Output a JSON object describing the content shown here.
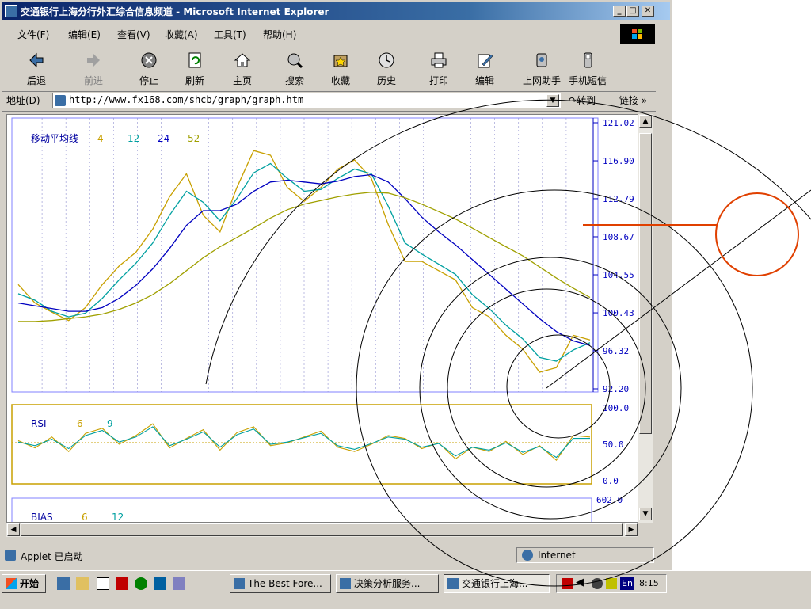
{
  "window": {
    "title": "交通银行上海分行外汇综合信息频道 - Microsoft Internet Explorer",
    "min": "_",
    "max": "□",
    "close": "✕"
  },
  "menu": [
    "文件(F)",
    "编辑(E)",
    "查看(V)",
    "收藏(A)",
    "工具(T)",
    "帮助(H)"
  ],
  "toolbar": [
    {
      "label": "后退",
      "icon": "back-arrow-icon"
    },
    {
      "label": "前进",
      "icon": "forward-arrow-icon"
    },
    {
      "label": "停止",
      "icon": "stop-icon"
    },
    {
      "label": "刷新",
      "icon": "refresh-icon"
    },
    {
      "label": "主页",
      "icon": "home-icon"
    },
    {
      "label": "搜索",
      "icon": "search-icon"
    },
    {
      "label": "收藏",
      "icon": "favorites-icon"
    },
    {
      "label": "历史",
      "icon": "history-icon"
    },
    {
      "label": "打印",
      "icon": "print-icon"
    },
    {
      "label": "编辑",
      "icon": "edit-icon"
    },
    {
      "label": "上网助手",
      "icon": "assistant-icon"
    },
    {
      "label": "手机短信",
      "icon": "sms-icon"
    }
  ],
  "address": {
    "label": "地址(D)",
    "url": "http://www.fx168.com/shcb/graph/graph.htm",
    "go": "转到",
    "links": "链接",
    "more": "»"
  },
  "chart_data": {
    "type": "line",
    "title": "移动平均线",
    "legend": [
      "4",
      "12",
      "24",
      "52"
    ],
    "legend_colors": [
      "#c8a000",
      "#00a0a0",
      "#0000c0",
      "#a0a000"
    ],
    "y_ticks": [
      "121.02",
      "116.90",
      "112.79",
      "108.67",
      "104.55",
      "100.43",
      "96.32",
      "92.20"
    ],
    "ylim": [
      92.2,
      121.02
    ],
    "series": [
      {
        "name": "4",
        "color": "#c8a000",
        "values": [
          103.5,
          101.5,
          100.5,
          99.6,
          101,
          103.5,
          105.5,
          107,
          109.5,
          113,
          115.5,
          111,
          109.2,
          114,
          118,
          117.5,
          114,
          112.5,
          114,
          116,
          117,
          115,
          110,
          106,
          106,
          105,
          104,
          101,
          100,
          98,
          96.5,
          94,
          94.5,
          98,
          97.5
        ]
      },
      {
        "name": "12",
        "color": "#00a0a0",
        "values": [
          102.5,
          101.8,
          100.6,
          100,
          100.4,
          102,
          104,
          105.8,
          108,
          111,
          113.6,
          112.4,
          110.4,
          112.8,
          115.6,
          116.6,
          115,
          113.6,
          113.8,
          115,
          116,
          115.5,
          112,
          108,
          106.8,
          105.7,
          104.6,
          102.4,
          100.9,
          99.1,
          97.6,
          95.6,
          95.2,
          96.4,
          97.2
        ]
      },
      {
        "name": "24",
        "color": "#0000c0",
        "values": [
          101.5,
          101.2,
          100.9,
          100.6,
          100.6,
          101,
          102,
          103.4,
          105.2,
          107.4,
          109.9,
          111.5,
          111.5,
          112.2,
          113.6,
          114.6,
          114.8,
          114.6,
          114.4,
          114.7,
          115.2,
          115.4,
          114.6,
          112.8,
          110.8,
          109.2,
          107.8,
          106.2,
          104.6,
          103,
          101.4,
          99.8,
          98.4,
          97.4,
          96.9
        ]
      },
      {
        "name": "52",
        "color": "#a0a000",
        "values": [
          99.5,
          99.5,
          99.6,
          99.8,
          100,
          100.3,
          100.8,
          101.5,
          102.4,
          103.6,
          105,
          106.4,
          107.6,
          108.6,
          109.6,
          110.7,
          111.6,
          112.2,
          112.6,
          113,
          113.3,
          113.5,
          113.4,
          112.9,
          112.2,
          111.4,
          110.6,
          109.6,
          108.6,
          107.6,
          106.6,
          105.4,
          104.2,
          103.1,
          102.1
        ]
      }
    ],
    "rsi": {
      "label": "RSI",
      "legend": [
        "6",
        "9"
      ],
      "y_ticks": [
        "100.0",
        "50.0",
        "0.0"
      ],
      "ylim": [
        0,
        100
      ],
      "series": [
        {
          "name": "6",
          "color": "#c8a000",
          "values": [
            55,
            45,
            60,
            40,
            65,
            72,
            50,
            62,
            78,
            45,
            58,
            70,
            42,
            66,
            74,
            48,
            52,
            60,
            68,
            46,
            40,
            50,
            62,
            58,
            44,
            52,
            30,
            46,
            40,
            54,
            36,
            48,
            28,
            62,
            60
          ]
        },
        {
          "name": "9",
          "color": "#00a0a0",
          "values": [
            53,
            48,
            57,
            44,
            62,
            69,
            53,
            60,
            74,
            48,
            57,
            67,
            46,
            63,
            71,
            50,
            53,
            59,
            65,
            48,
            43,
            51,
            60,
            57,
            46,
            51,
            34,
            46,
            42,
            52,
            39,
            47,
            32,
            58,
            58
          ]
        }
      ]
    },
    "bias": {
      "label": "BIAS",
      "legend": [
        "6",
        "12"
      ],
      "y_ticks": [
        "602.0"
      ]
    }
  },
  "status": {
    "text": "Applet 已启动",
    "zone": "Internet"
  },
  "taskbar": {
    "start": "开始",
    "tasks": [
      "The Best Fore...",
      "决策分析服务...",
      "交通银行上海..."
    ],
    "clock": "8:15",
    "ime": "En"
  }
}
